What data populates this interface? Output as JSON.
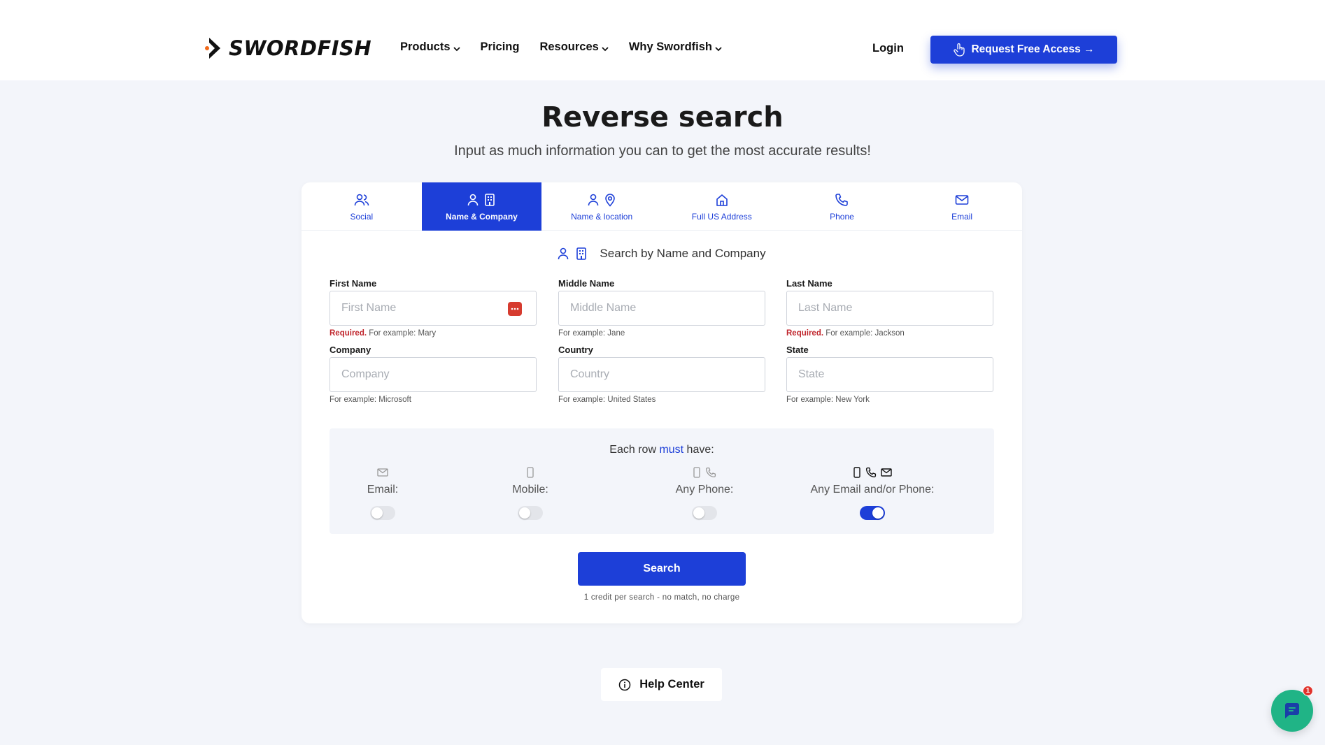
{
  "brand": {
    "name": "SWORDFISH",
    "accent": "#1d3fd8",
    "logo_icon": "chevron-arrow-logo"
  },
  "nav": {
    "items": [
      {
        "label": "Products",
        "has_dropdown": true
      },
      {
        "label": "Pricing",
        "has_dropdown": false
      },
      {
        "label": "Resources",
        "has_dropdown": true
      },
      {
        "label": "Why Swordfish",
        "has_dropdown": true
      }
    ],
    "login": "Login",
    "cta": "Request Free Access →"
  },
  "hero": {
    "title": "Reverse search",
    "subtitle": "Input as much information you can to get the most accurate results!"
  },
  "tabs": [
    {
      "label": "Social",
      "icons": [
        "users-icon"
      ],
      "active": false
    },
    {
      "label": "Name & Company",
      "icons": [
        "person-icon",
        "building-icon"
      ],
      "active": true
    },
    {
      "label": "Name & location",
      "icons": [
        "person-icon",
        "location-pin-icon"
      ],
      "active": false
    },
    {
      "label": "Full US Address",
      "icons": [
        "home-icon"
      ],
      "active": false
    },
    {
      "label": "Phone",
      "icons": [
        "phone-icon"
      ],
      "active": false
    },
    {
      "label": "Email",
      "icons": [
        "mail-icon"
      ],
      "active": false
    }
  ],
  "section": {
    "title": "Search by Name and Company"
  },
  "fields": {
    "first_name": {
      "label": "First Name",
      "placeholder": "First Name",
      "required": "Required.",
      "hint": " For example: Mary"
    },
    "middle_name": {
      "label": "Middle Name",
      "placeholder": "Middle Name",
      "hint": "For example: Jane"
    },
    "last_name": {
      "label": "Last Name",
      "placeholder": "Last Name",
      "required": "Required.",
      "hint": " For example: Jackson"
    },
    "company": {
      "label": "Company",
      "placeholder": "Company",
      "hint": "For example: Microsoft"
    },
    "country": {
      "label": "Country",
      "placeholder": "Country",
      "hint": "For example: United States"
    },
    "state": {
      "label": "State",
      "placeholder": "State",
      "hint": "For example: New York"
    }
  },
  "must_have": {
    "prefix": "Each row ",
    "emphasis": "must",
    "suffix": " have:",
    "options": [
      {
        "label": "Email:",
        "enabled": false
      },
      {
        "label": "Mobile:",
        "enabled": false
      },
      {
        "label": "Any Phone:",
        "enabled": false
      },
      {
        "label": "Any Email and/or Phone:",
        "enabled": true
      }
    ]
  },
  "search": {
    "label": "Search",
    "note": "1 credit per search - no match, no charge"
  },
  "help": {
    "label": "Help Center"
  },
  "chat": {
    "badge": "1"
  }
}
